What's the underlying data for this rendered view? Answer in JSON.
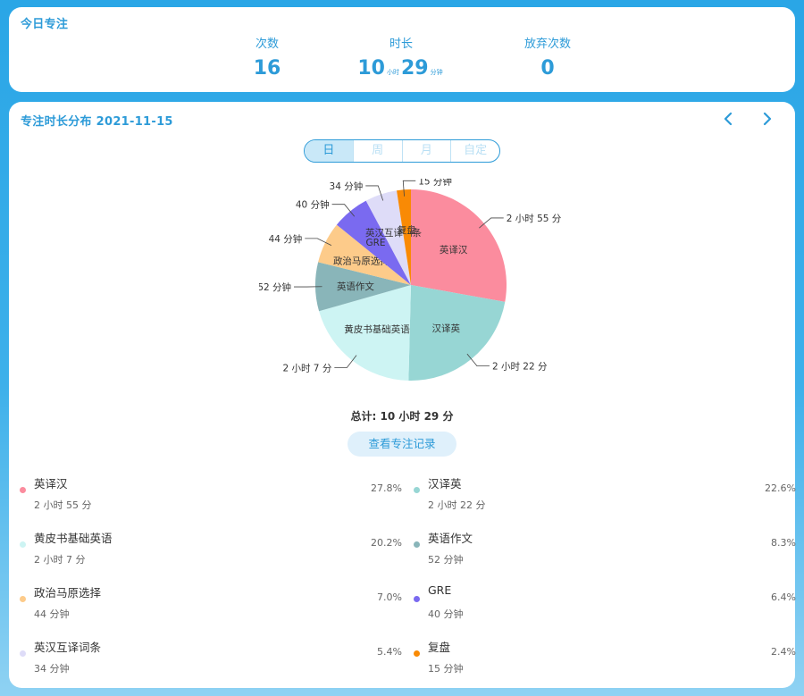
{
  "today": {
    "title": "今日专注",
    "count_label": "次数",
    "count_value": "16",
    "duration_label": "时长",
    "duration_hours": "10",
    "duration_hours_unit": "小时",
    "duration_minutes": "29",
    "duration_minutes_unit": "分钟",
    "abandon_label": "放弃次数",
    "abandon_value": "0"
  },
  "distribution": {
    "title": "专注时长分布 2021-11-15",
    "prev_icon": "chevron-left-icon",
    "next_icon": "chevron-right-icon",
    "tabs": [
      "日",
      "周",
      "月",
      "自定"
    ],
    "active_tab": "日",
    "total_text": "总计: 10 小时 29 分",
    "record_button": "查看专注记录"
  },
  "chart_data": {
    "type": "pie",
    "title": "",
    "slices": [
      {
        "name": "英译汉",
        "minutes": 175,
        "percent": 27.8,
        "duration": "2 小时 55 分",
        "color": "#fb8c9e"
      },
      {
        "name": "汉译英",
        "minutes": 142,
        "percent": 22.6,
        "duration": "2 小时 22 分",
        "color": "#97d6d4"
      },
      {
        "name": "黄皮书基础英语",
        "minutes": 127,
        "percent": 20.2,
        "duration": "2 小时 7 分",
        "color": "#cdf4f3"
      },
      {
        "name": "英语作文",
        "minutes": 52,
        "percent": 8.3,
        "duration": "52 分钟",
        "color": "#89b5b9"
      },
      {
        "name": "政治马原选择",
        "minutes": 44,
        "percent": 7.0,
        "duration": "44 分钟",
        "color": "#fdcb8a"
      },
      {
        "name": "GRE",
        "minutes": 40,
        "percent": 6.4,
        "duration": "40 分钟",
        "color": "#7a6af0"
      },
      {
        "name": "英汉互译词条",
        "minutes": 34,
        "percent": 5.4,
        "duration": "34 分钟",
        "color": "#dedcf8"
      },
      {
        "name": "复盘",
        "minutes": 15,
        "percent": 2.4,
        "duration": "15 分钟",
        "color": "#f98a05"
      }
    ],
    "outer_labels": [
      "2 小时 55 分",
      "2 小时 22 分",
      "2 小时 7 分",
      "52 分钟",
      "44 分钟",
      "40 分钟",
      "34 分钟",
      "15 分钟"
    ],
    "legend": [
      {
        "name": "英译汉",
        "duration": "2 小时 55 分",
        "percent": "27.8%"
      },
      {
        "name": "汉译英",
        "duration": "2 小时 22 分",
        "percent": "22.6%"
      },
      {
        "name": "黄皮书基础英语",
        "duration": "2 小时 7 分",
        "percent": "20.2%"
      },
      {
        "name": "英语作文",
        "duration": "52 分钟",
        "percent": "8.3%"
      },
      {
        "name": "政治马原选择",
        "duration": "44 分钟",
        "percent": "7.0%"
      },
      {
        "name": "GRE",
        "duration": "40 分钟",
        "percent": "6.4%"
      },
      {
        "name": "英汉互译词条",
        "duration": "34 分钟",
        "percent": "5.4%"
      },
      {
        "name": "复盘",
        "duration": "15 分钟",
        "percent": "2.4%"
      }
    ]
  }
}
